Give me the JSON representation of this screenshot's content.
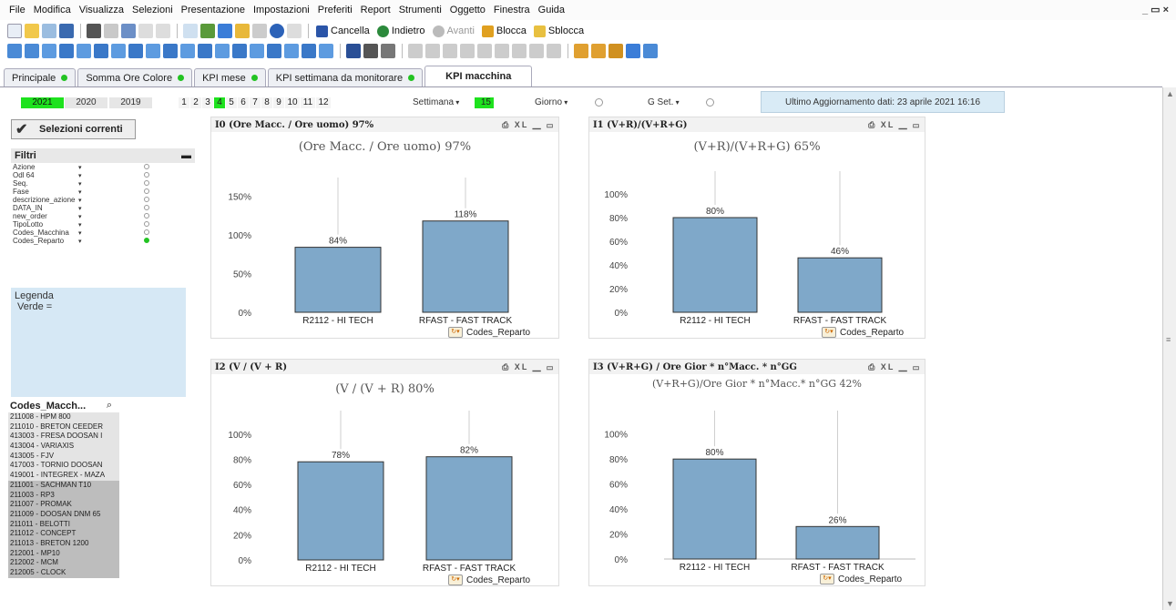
{
  "menu": [
    "File",
    "Modifica",
    "Visualizza",
    "Selezioni",
    "Presentazione",
    "Impostazioni",
    "Preferiti",
    "Report",
    "Strumenti",
    "Oggetto",
    "Finestra",
    "Guida"
  ],
  "window_controls": "_ ▭ ×",
  "toolbar": {
    "cancella": "Cancella",
    "indietro": "Indietro",
    "avanti": "Avanti",
    "blocca": "Blocca",
    "sblocca": "Sblocca"
  },
  "tabs": [
    {
      "label": "Principale",
      "dot": true
    },
    {
      "label": "Somma Ore Colore",
      "dot": true
    },
    {
      "label": "KPI mese",
      "dot": true
    },
    {
      "label": "KPI settimana da monitorare",
      "dot": true
    },
    {
      "label": "KPI macchina",
      "dot": false
    }
  ],
  "years": [
    "2021",
    "2020",
    "2019"
  ],
  "months": [
    "1",
    "2",
    "3",
    "4",
    "5",
    "6",
    "7",
    "8",
    "9",
    "10",
    "11",
    "12"
  ],
  "selected_month": "4",
  "settimana": {
    "label": "Settimana",
    "value": "15"
  },
  "giorno_label": "Giorno",
  "gset_label": "G Set.",
  "update_text": "Ultimo Aggiornamento dati: 23 aprile 2021  16:16",
  "selezioni_label": "Selezioni correnti",
  "filtri": {
    "title": "Filtri",
    "rows": [
      {
        "name": "Azione",
        "selected": false
      },
      {
        "name": "Odl 64",
        "selected": false
      },
      {
        "name": "Seq.",
        "selected": false
      },
      {
        "name": "Fase",
        "selected": false
      },
      {
        "name": "descrizione_azione",
        "selected": false
      },
      {
        "name": "DATA_IN",
        "selected": false
      },
      {
        "name": "new_order",
        "selected": false
      },
      {
        "name": "TipoLotto",
        "selected": false
      },
      {
        "name": "Codes_Macchina",
        "selected": false
      },
      {
        "name": "Codes_Reparto",
        "selected": true
      }
    ]
  },
  "legenda": {
    "title": "Legenda",
    "line": "Verde ="
  },
  "codes_macchina": {
    "title": "Codes_Macch...",
    "items": [
      {
        "label": "211008 - HPM 800",
        "dark": false
      },
      {
        "label": "211010 - BRETON CEEDER",
        "dark": false
      },
      {
        "label": "413003 - FRESA DOOSAN I",
        "dark": false
      },
      {
        "label": "413004 - VARIAXIS",
        "dark": false
      },
      {
        "label": "413005 - FJV",
        "dark": false
      },
      {
        "label": "417003 - TORNIO DOOSAN",
        "dark": false
      },
      {
        "label": "419001 - INTEGREX - MAZA",
        "dark": false
      },
      {
        "label": "211001 - SACHMAN T10",
        "dark": true
      },
      {
        "label": "211003 - RP3",
        "dark": true
      },
      {
        "label": "211007 - PROMAK",
        "dark": true
      },
      {
        "label": "211009 - DOOSAN DNM 65",
        "dark": true
      },
      {
        "label": "211011 - BELOTTI",
        "dark": true
      },
      {
        "label": "211012 - CONCEPT",
        "dark": true
      },
      {
        "label": "211013 - BRETON 1200",
        "dark": true
      },
      {
        "label": "212001 - MP10",
        "dark": true
      },
      {
        "label": "212002 - MCM",
        "dark": true
      },
      {
        "label": "212005 - CLOCK",
        "dark": true
      }
    ]
  },
  "dimension_label": "Codes_Reparto",
  "colors": {
    "bar": "#7fa8c9",
    "bar_stroke": "#333333",
    "green": "#1ee21e",
    "legend_bg": "#d6e8f5"
  },
  "chart_data": [
    {
      "type": "bar",
      "header": "I0 (Ore Macc. / Ore uomo) 97%",
      "title": "(Ore Macc. / Ore uomo) 97%",
      "categories": [
        "R2112 - HI TECH",
        "RFAST - FAST TRACK"
      ],
      "values": [
        84,
        118
      ],
      "value_labels": [
        "84%",
        "118%"
      ],
      "yticks": [
        "0%",
        "50%",
        "100%",
        "150%"
      ],
      "ylim": [
        0,
        160
      ],
      "xlabel": "Codes_Reparto"
    },
    {
      "type": "bar",
      "header": "I1 (V+R)/(V+R+G)",
      "title": "(V+R)/(V+R+G) 65%",
      "categories": [
        "R2112 - HI TECH",
        "RFAST - FAST TRACK"
      ],
      "values": [
        80,
        46
      ],
      "value_labels": [
        "80%",
        "46%"
      ],
      "yticks": [
        "0%",
        "20%",
        "40%",
        "60%",
        "80%",
        "100%"
      ],
      "ylim": [
        0,
        110
      ],
      "xlabel": "Codes_Reparto"
    },
    {
      "type": "bar",
      "header": "I2 (V / (V + R)",
      "title": "(V / (V + R) 80%",
      "categories": [
        "R2112 - HI TECH",
        "RFAST - FAST TRACK"
      ],
      "values": [
        78,
        82
      ],
      "value_labels": [
        "78%",
        "82%"
      ],
      "yticks": [
        "0%",
        "20%",
        "40%",
        "60%",
        "80%",
        "100%"
      ],
      "ylim": [
        0,
        110
      ],
      "xlabel": "Codes_Reparto"
    },
    {
      "type": "bar",
      "header": "I3 (V+R+G) / Ore Gior * n°Macc. * n°GG",
      "title": "(V+R+G)/Ore Gior * n°Macc.* n°GG 42%",
      "categories": [
        "R2112 - HI TECH",
        "RFAST - FAST TRACK"
      ],
      "values": [
        80,
        26
      ],
      "value_labels": [
        "80%",
        "26%"
      ],
      "yticks": [
        "0%",
        "20%",
        "40%",
        "60%",
        "80%",
        "100%"
      ],
      "ylim": [
        0,
        110
      ],
      "xlabel": "Codes_Reparto"
    }
  ]
}
